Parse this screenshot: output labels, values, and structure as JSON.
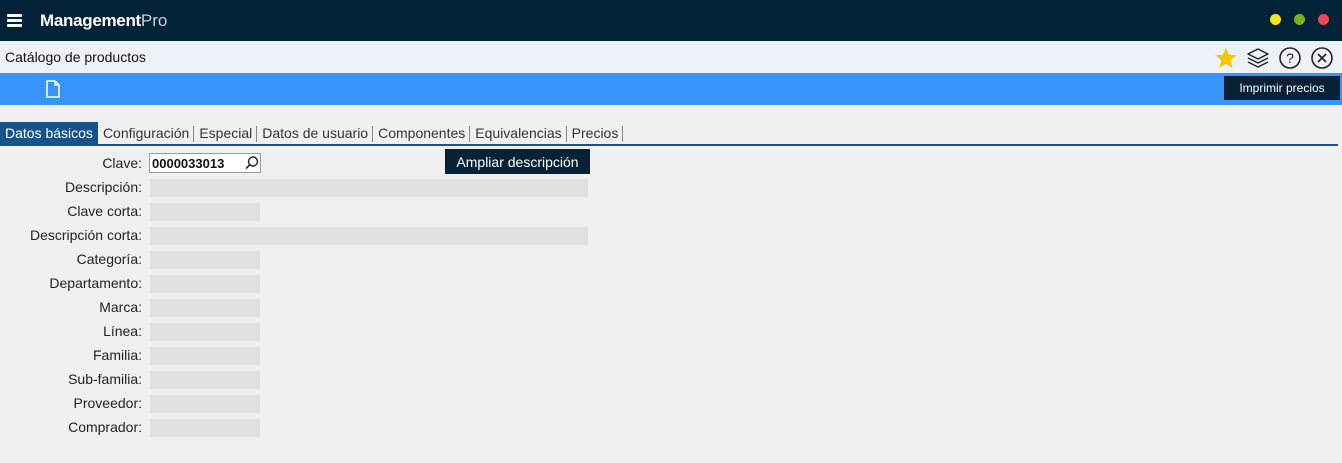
{
  "app": {
    "brand_bold": "Management",
    "brand_light": "Pro",
    "window_controls": {
      "minimize_color": "#f5e61a",
      "maximize_color": "#7fb01f",
      "close_color": "#e9494f"
    }
  },
  "header": {
    "title": "Catálogo de productos",
    "icons": [
      "star-icon",
      "layers-icon",
      "help-icon",
      "close-circle-icon"
    ],
    "star_color": "#f7c800"
  },
  "toolbar": {
    "new_icon": "document-icon",
    "print_label": "Imprimir precios",
    "accent_color": "#3894fa"
  },
  "tabs": [
    {
      "label": "Datos básicos",
      "active": true
    },
    {
      "label": "Configuración",
      "active": false
    },
    {
      "label": "Especial",
      "active": false
    },
    {
      "label": "Datos de usuario",
      "active": false
    },
    {
      "label": "Componentes",
      "active": false
    },
    {
      "label": "Equivalencias",
      "active": false
    },
    {
      "label": "Precios",
      "active": false
    }
  ],
  "form": {
    "clave_label": "Clave:",
    "clave_value": "0000033013",
    "expand_label": "Ampliar descripción",
    "fields": [
      {
        "label": "Descripción:",
        "value": ""
      },
      {
        "label": "Clave corta:",
        "value": ""
      },
      {
        "label": "Descripción corta:",
        "value": ""
      },
      {
        "label": "Categoría:",
        "value": ""
      },
      {
        "label": "Departamento:",
        "value": ""
      },
      {
        "label": "Marca:",
        "value": ""
      },
      {
        "label": "Línea:",
        "value": ""
      },
      {
        "label": "Familia:",
        "value": ""
      },
      {
        "label": "Sub-familia:",
        "value": ""
      },
      {
        "label": "Proveedor:",
        "value": ""
      },
      {
        "label": "Comprador:",
        "value": ""
      }
    ]
  }
}
